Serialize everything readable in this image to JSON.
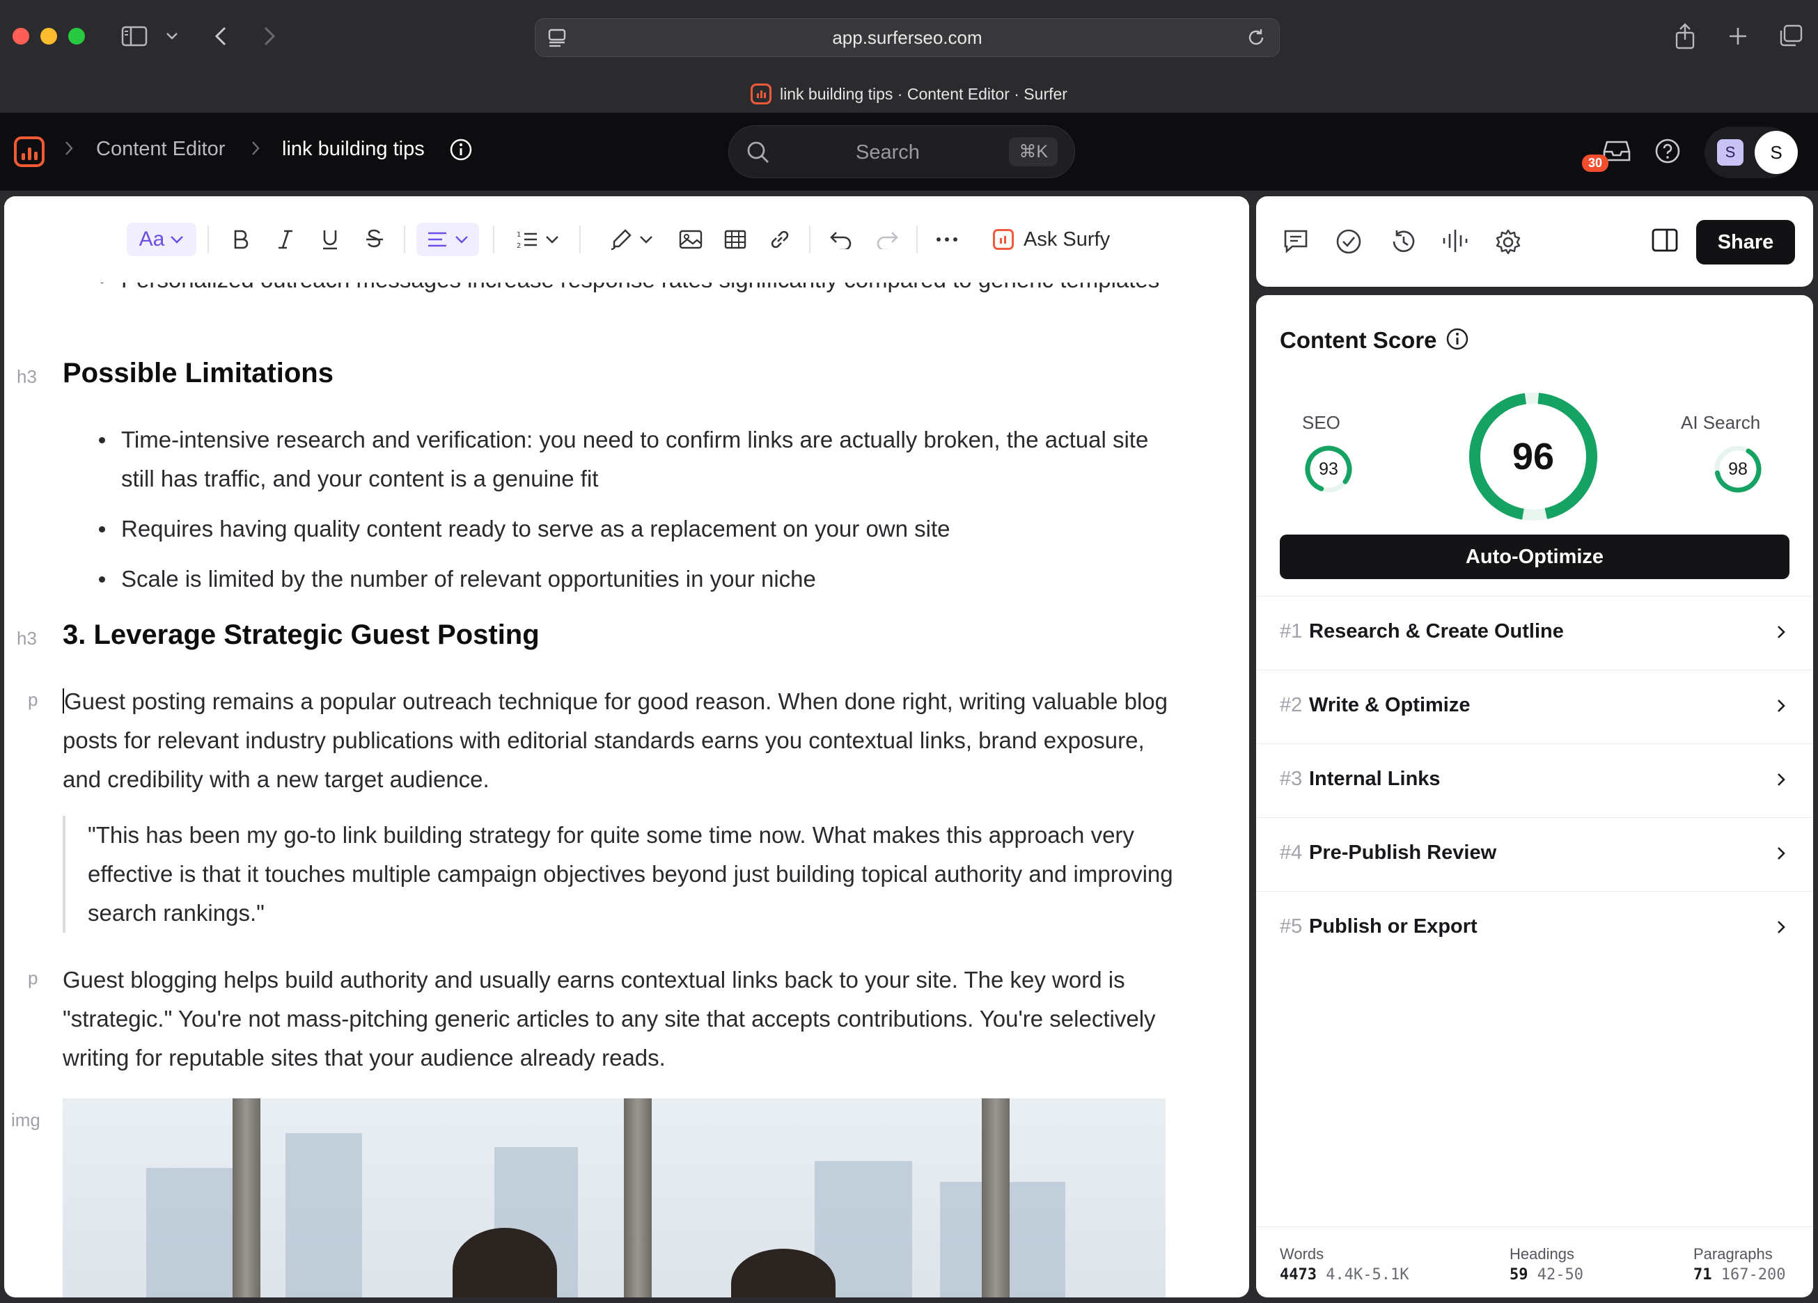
{
  "browser": {
    "url": "app.surferseo.com",
    "tab_title": "link building tips · Content Editor · Surfer"
  },
  "header": {
    "breadcrumb_root": "Content Editor",
    "breadcrumb_current": "link building tips",
    "search_label": "Search",
    "search_shortcut": "⌘K",
    "notification_count": "30",
    "avatar_workspace": "S",
    "avatar_user": "S"
  },
  "toolbar": {
    "font_label": "Aa",
    "ask_surfy": "Ask Surfy"
  },
  "document": {
    "top_bullet": "Personalized outreach messages increase response rates significantly compared to generic templates",
    "h3_limitations_tag": "h3",
    "h3_limitations": "Possible Limitations",
    "limitations": [
      "Time-intensive research and verification: you need to confirm links are actually broken, the actual site still has traffic, and your content is a genuine fit",
      "Requires having quality content ready to serve as a replacement on your own site",
      "Scale is limited by the number of relevant opportunities in your niche"
    ],
    "h3_guest_tag": "h3",
    "h3_guest": "3. Leverage Strategic Guest Posting",
    "p1_tag": "p",
    "p1": "Guest posting remains a popular outreach technique for good reason. When done right, writing valuable blog posts for relevant industry publications with editorial standards earns you contextual links, brand exposure, and credibility with a new target audience.",
    "quote": "\"This has been my go-to link building strategy for quite some time now. What makes this approach very effective is that it touches multiple campaign objectives beyond just building topical authority and improving search rankings.\"",
    "p2_tag": "p",
    "p2": "Guest blogging helps build authority and usually earns contextual links back to your site. The key word is \"strategic.\" You're not mass-pitching generic articles to any site that accepts contributions. You're selectively writing for reputable sites that your audience already reads.",
    "img_tag": "img"
  },
  "panel": {
    "share_label": "Share",
    "content_score_title": "Content Score",
    "seo_label": "SEO",
    "seo_score": "93",
    "overall_score": "96",
    "ai_label": "AI Search",
    "ai_score": "98",
    "auto_optimize": "Auto-Optimize",
    "steps": [
      {
        "num": "#1",
        "label": "Research & Create Outline"
      },
      {
        "num": "#2",
        "label": "Write & Optimize"
      },
      {
        "num": "#3",
        "label": "Internal Links"
      },
      {
        "num": "#4",
        "label": "Pre-Publish Review"
      },
      {
        "num": "#5",
        "label": "Publish or Export"
      }
    ],
    "stats": {
      "words_label": "Words",
      "words_value": "4473",
      "words_range": "4.4K-5.1K",
      "headings_label": "Headings",
      "headings_value": "59",
      "headings_range": "42-50",
      "paragraphs_label": "Paragraphs",
      "paragraphs_value": "71",
      "paragraphs_range": "167-200"
    }
  },
  "colors": {
    "accent_orange": "#f05a35",
    "score_green": "#16a263",
    "toolbar_purple": "#6c4ee6"
  }
}
